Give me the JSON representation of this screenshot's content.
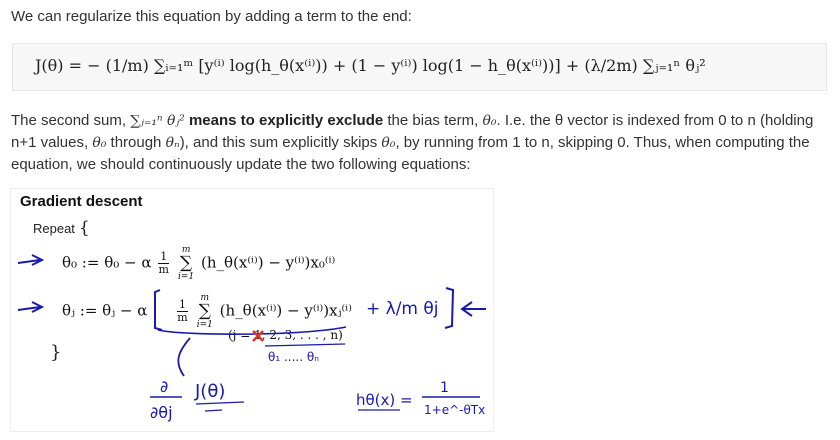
{
  "intro": "We can regularize this equation by adding a term to the end:",
  "cost_equation": "J(θ) = − (1/m) ∑ᵢ₌₁ᵐ [y⁽ⁱ⁾ log(h_θ(x⁽ⁱ⁾)) + (1 − y⁽ⁱ⁾) log(1 − h_θ(x⁽ⁱ⁾))] + (λ/2m) ∑ⱼ₌₁ⁿ θⱼ²",
  "paragraph": {
    "p1": "The second sum, ",
    "sum_expr": "∑ⱼ₌₁ⁿ θⱼ²",
    "bold": "means to explicitly exclude",
    "p2": " the bias term, ",
    "theta0": "θ₀",
    "p3": ". I.e. the θ vector is indexed from 0 to n (holding n+1 values, ",
    "theta0b": "θ₀",
    "p4": " through ",
    "thetan": "θₙ",
    "p5": "), and this sum explicitly skips ",
    "theta0c": "θ₀",
    "p6": ", by running from 1 to n, skipping 0. Thus, when computing the equation, we should continuously update the two following equations:"
  },
  "slide": {
    "title": "Gradient descent",
    "repeat": "Repeat",
    "open_brace": "{",
    "close_brace": "}",
    "update0": {
      "lhs": "θ₀ := θ₀ − α",
      "frac_num": "1",
      "frac_den": "m",
      "sum_top": "m",
      "sum_bot": "i=1",
      "body": "(h_θ(x⁽ⁱ⁾) − y⁽ⁱ⁾)x₀⁽ⁱ⁾"
    },
    "updatej": {
      "lhs": "θⱼ := θⱼ − α",
      "frac_num": "1",
      "frac_den": "m",
      "sum_top": "m",
      "sum_bot": "i=1",
      "body": "(h_θ(x⁽ⁱ⁾) − y⁽ⁱ⁾)xⱼ⁽ⁱ⁾"
    },
    "j_range": "(j = 1, 2, 3, . . . , n)",
    "handwriting": {
      "reg_term": "+ λ/m θj",
      "thetas": "θ₁ ..... θₙ",
      "derivative_num": "∂",
      "derivative_den": "∂θj",
      "derivative_fn": "J(θ)",
      "hypothesis_lhs": "hθ(x) =",
      "hypothesis_num": "1",
      "hypothesis_den": "1+e^-θTx"
    }
  },
  "colors": {
    "ink": "#1a1aa8",
    "cross": "#d9362b",
    "box": "#f7f7f7"
  }
}
